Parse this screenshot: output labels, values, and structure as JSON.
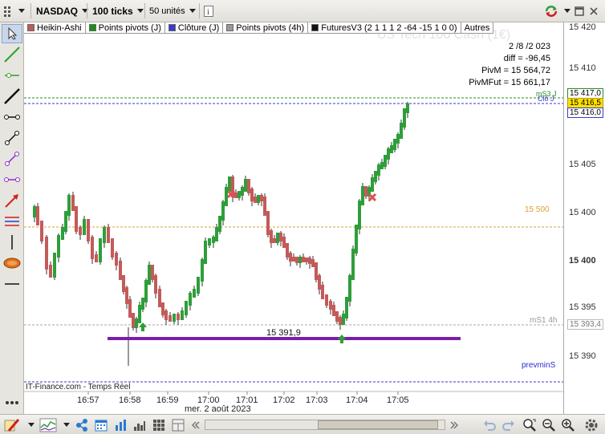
{
  "toolbar": {
    "symbol": "NASDAQ",
    "ticks": "100 ticks",
    "units": "50 unités",
    "info_icon": "info-icon"
  },
  "legend": [
    {
      "label": "Heikin-Ashi",
      "color": "#c05a5a"
    },
    {
      "label": "Points pivots (J)",
      "color": "#1a8f1a"
    },
    {
      "label": "Clôture (J)",
      "color": "#3a3ad0"
    },
    {
      "label": "Points pivots (4h)",
      "color": "#999999"
    },
    {
      "label": "FuturesV3 (2 1 1 1 2 -64 -15 1 0 0)",
      "color": "#111111"
    },
    {
      "label": "Autres",
      "color": ""
    }
  ],
  "watermark": "US Tech 100 Cash (1€)",
  "info": {
    "date": "2 /8 /2 023",
    "diff": "diff = -96,45",
    "pivm": "PivM = 15 564,72",
    "pivmfut": "PivMFut = 15 661,17"
  },
  "labels": {
    "ms3": "mS3 J",
    "cloj": "Clô J",
    "l15500": "15 500",
    "ms1": "mS1 4h",
    "support": "15 391,9",
    "prevmin": "prevminS",
    "source": "IT-Finance.com - Temps Réel",
    "date_axis": "mer. 2 août 2023"
  },
  "yaxis": {
    "ticks": [
      "15 420",
      "15 410",
      "15 405",
      "15 400",
      "15 395",
      "15 390"
    ],
    "tags": [
      "15 417,0",
      "15 416,5",
      "15 416,0",
      "15 393,4"
    ]
  },
  "xaxis": {
    "ticks": [
      "16:57",
      "16:58",
      "16:59",
      "17:00",
      "17:01",
      "17:02",
      "17:03",
      "17:04",
      "17:05"
    ]
  },
  "colors": {
    "bull": "#2e9e3a",
    "bear": "#c45a5a",
    "purple": "#7a1fa8",
    "orange": "#e0a030",
    "green_dash": "#2a8a2a",
    "blue_dash": "#3a3ad0"
  }
}
